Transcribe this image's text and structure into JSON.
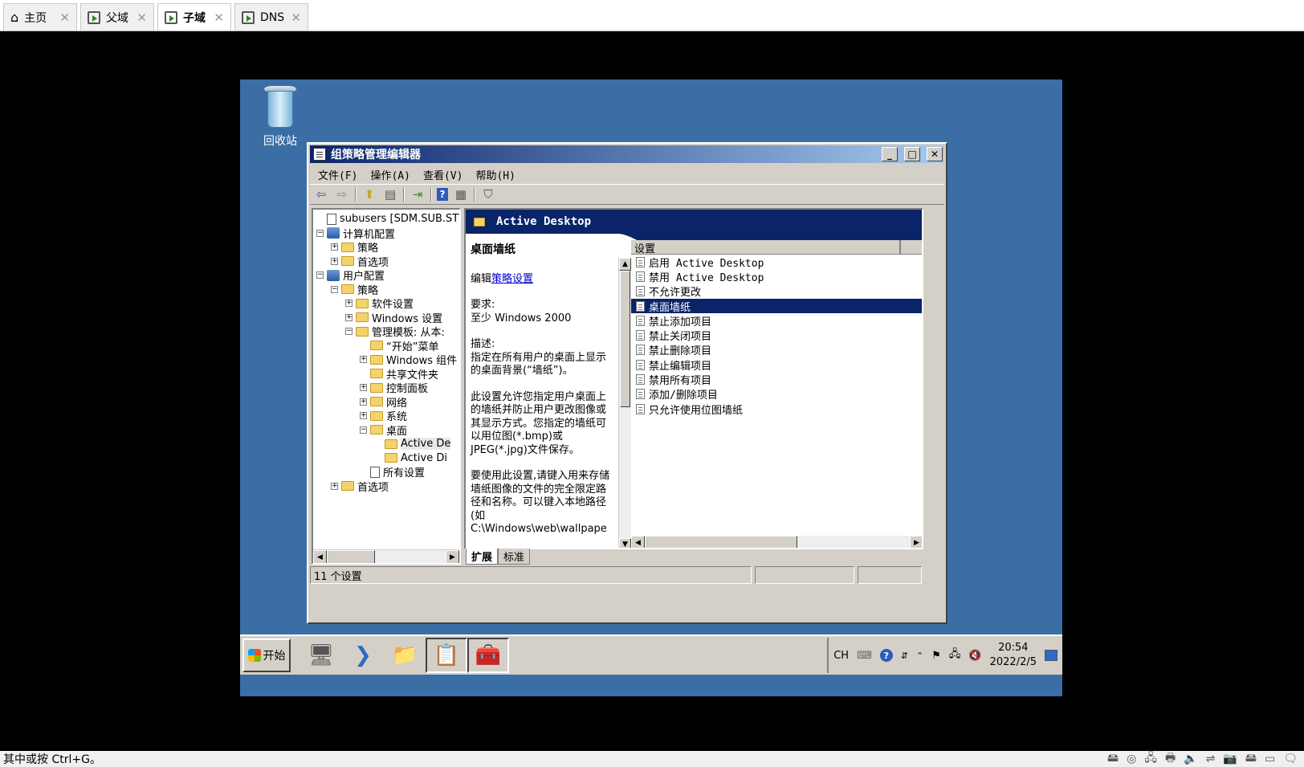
{
  "host_tabs": [
    {
      "label": "主页",
      "icon": "home-icon",
      "active": false
    },
    {
      "label": "父域",
      "icon": "vm-icon",
      "active": false
    },
    {
      "label": "子域",
      "icon": "vm-icon",
      "active": true
    },
    {
      "label": "DNS",
      "icon": "vm-icon",
      "active": false
    }
  ],
  "close_glyph": "✕",
  "desktop": {
    "recycle_label": "回收站"
  },
  "window": {
    "title": "组策略管理编辑器",
    "buttons": {
      "minimize": "_",
      "maximize": "□",
      "close": "✕"
    },
    "menus": [
      "文件(F)",
      "操作(A)",
      "查看(V)",
      "帮助(H)"
    ]
  },
  "tree": [
    {
      "label": "subusers [SDM.SUB.STY",
      "level": 0,
      "exp": "",
      "icon": "doc"
    },
    {
      "label": "计算机配置",
      "level": 0,
      "exp": "⊟",
      "icon": "cfg"
    },
    {
      "label": "策略",
      "level": 1,
      "exp": "⊞",
      "icon": "folder"
    },
    {
      "label": "首选项",
      "level": 1,
      "exp": "⊞",
      "icon": "folder"
    },
    {
      "label": "用户配置",
      "level": 0,
      "exp": "⊟",
      "icon": "cfg"
    },
    {
      "label": "策略",
      "level": 1,
      "exp": "⊟",
      "icon": "folder"
    },
    {
      "label": "软件设置",
      "level": 2,
      "exp": "⊞",
      "icon": "folder"
    },
    {
      "label": "Windows 设置",
      "level": 2,
      "exp": "⊞",
      "icon": "folder"
    },
    {
      "label": "管理模板: 从本:",
      "level": 2,
      "exp": "⊟",
      "icon": "folder"
    },
    {
      "label": "“开始”菜单",
      "level": 3,
      "exp": "",
      "icon": "folder"
    },
    {
      "label": "Windows 组件",
      "level": 3,
      "exp": "⊞",
      "icon": "folder"
    },
    {
      "label": "共享文件夹",
      "level": 3,
      "exp": "",
      "icon": "folder"
    },
    {
      "label": "控制面板",
      "level": 3,
      "exp": "⊞",
      "icon": "folder"
    },
    {
      "label": "网络",
      "level": 3,
      "exp": "⊞",
      "icon": "folder"
    },
    {
      "label": "系统",
      "level": 3,
      "exp": "⊞",
      "icon": "folder"
    },
    {
      "label": "桌面",
      "level": 3,
      "exp": "⊟",
      "icon": "folder"
    },
    {
      "label": "Active De",
      "level": 4,
      "exp": "",
      "icon": "folder",
      "selected": true
    },
    {
      "label": "Active Di",
      "level": 4,
      "exp": "",
      "icon": "folder"
    },
    {
      "label": "所有设置",
      "level": 3,
      "exp": "",
      "icon": "doc"
    },
    {
      "label": "首选项",
      "level": 1,
      "exp": "⊞",
      "icon": "folder"
    }
  ],
  "right": {
    "header": "Active Desktop",
    "desc": {
      "title": "桌面墙纸",
      "edit_prefix": "编辑",
      "edit_link": "策略设置",
      "req_label": "要求:",
      "req_value": "至少 Windows 2000",
      "desc_label": "描述:",
      "desc_p1": "指定在所有用户的桌面上显示的桌面背景(“墙纸”)。",
      "desc_p2": "此设置允许您指定用户桌面上的墙纸并防止用户更改图像或其显示方式。您指定的墙纸可以用位图(*.bmp)或 JPEG(*.jpg)文件保存。",
      "desc_p3": "要使用此设置,请键入用来存储墙纸图像的文件的完全限定路径和名称。可以键入本地路径(如 C:\\Windows\\web\\wallpape"
    },
    "list_header": "设置",
    "items": [
      {
        "label": "启用 Active Desktop",
        "selected": false
      },
      {
        "label": "禁用 Active Desktop",
        "selected": false
      },
      {
        "label": "不允许更改",
        "selected": false
      },
      {
        "label": "桌面墙纸",
        "selected": true
      },
      {
        "label": "禁止添加项目",
        "selected": false
      },
      {
        "label": "禁止关闭项目",
        "selected": false
      },
      {
        "label": "禁止删除项目",
        "selected": false
      },
      {
        "label": "禁止编辑项目",
        "selected": false
      },
      {
        "label": "禁用所有项目",
        "selected": false
      },
      {
        "label": "添加/删除项目",
        "selected": false
      },
      {
        "label": "只允许使用位图墙纸",
        "selected": false
      }
    ]
  },
  "view_tabs": [
    "扩展",
    "标准"
  ],
  "status": "11 个设置",
  "taskbar": {
    "start": "开始",
    "lang": "CH",
    "time": "20:54",
    "date": "2022/2/5"
  },
  "host_status": "其中或按 Ctrl+G。"
}
